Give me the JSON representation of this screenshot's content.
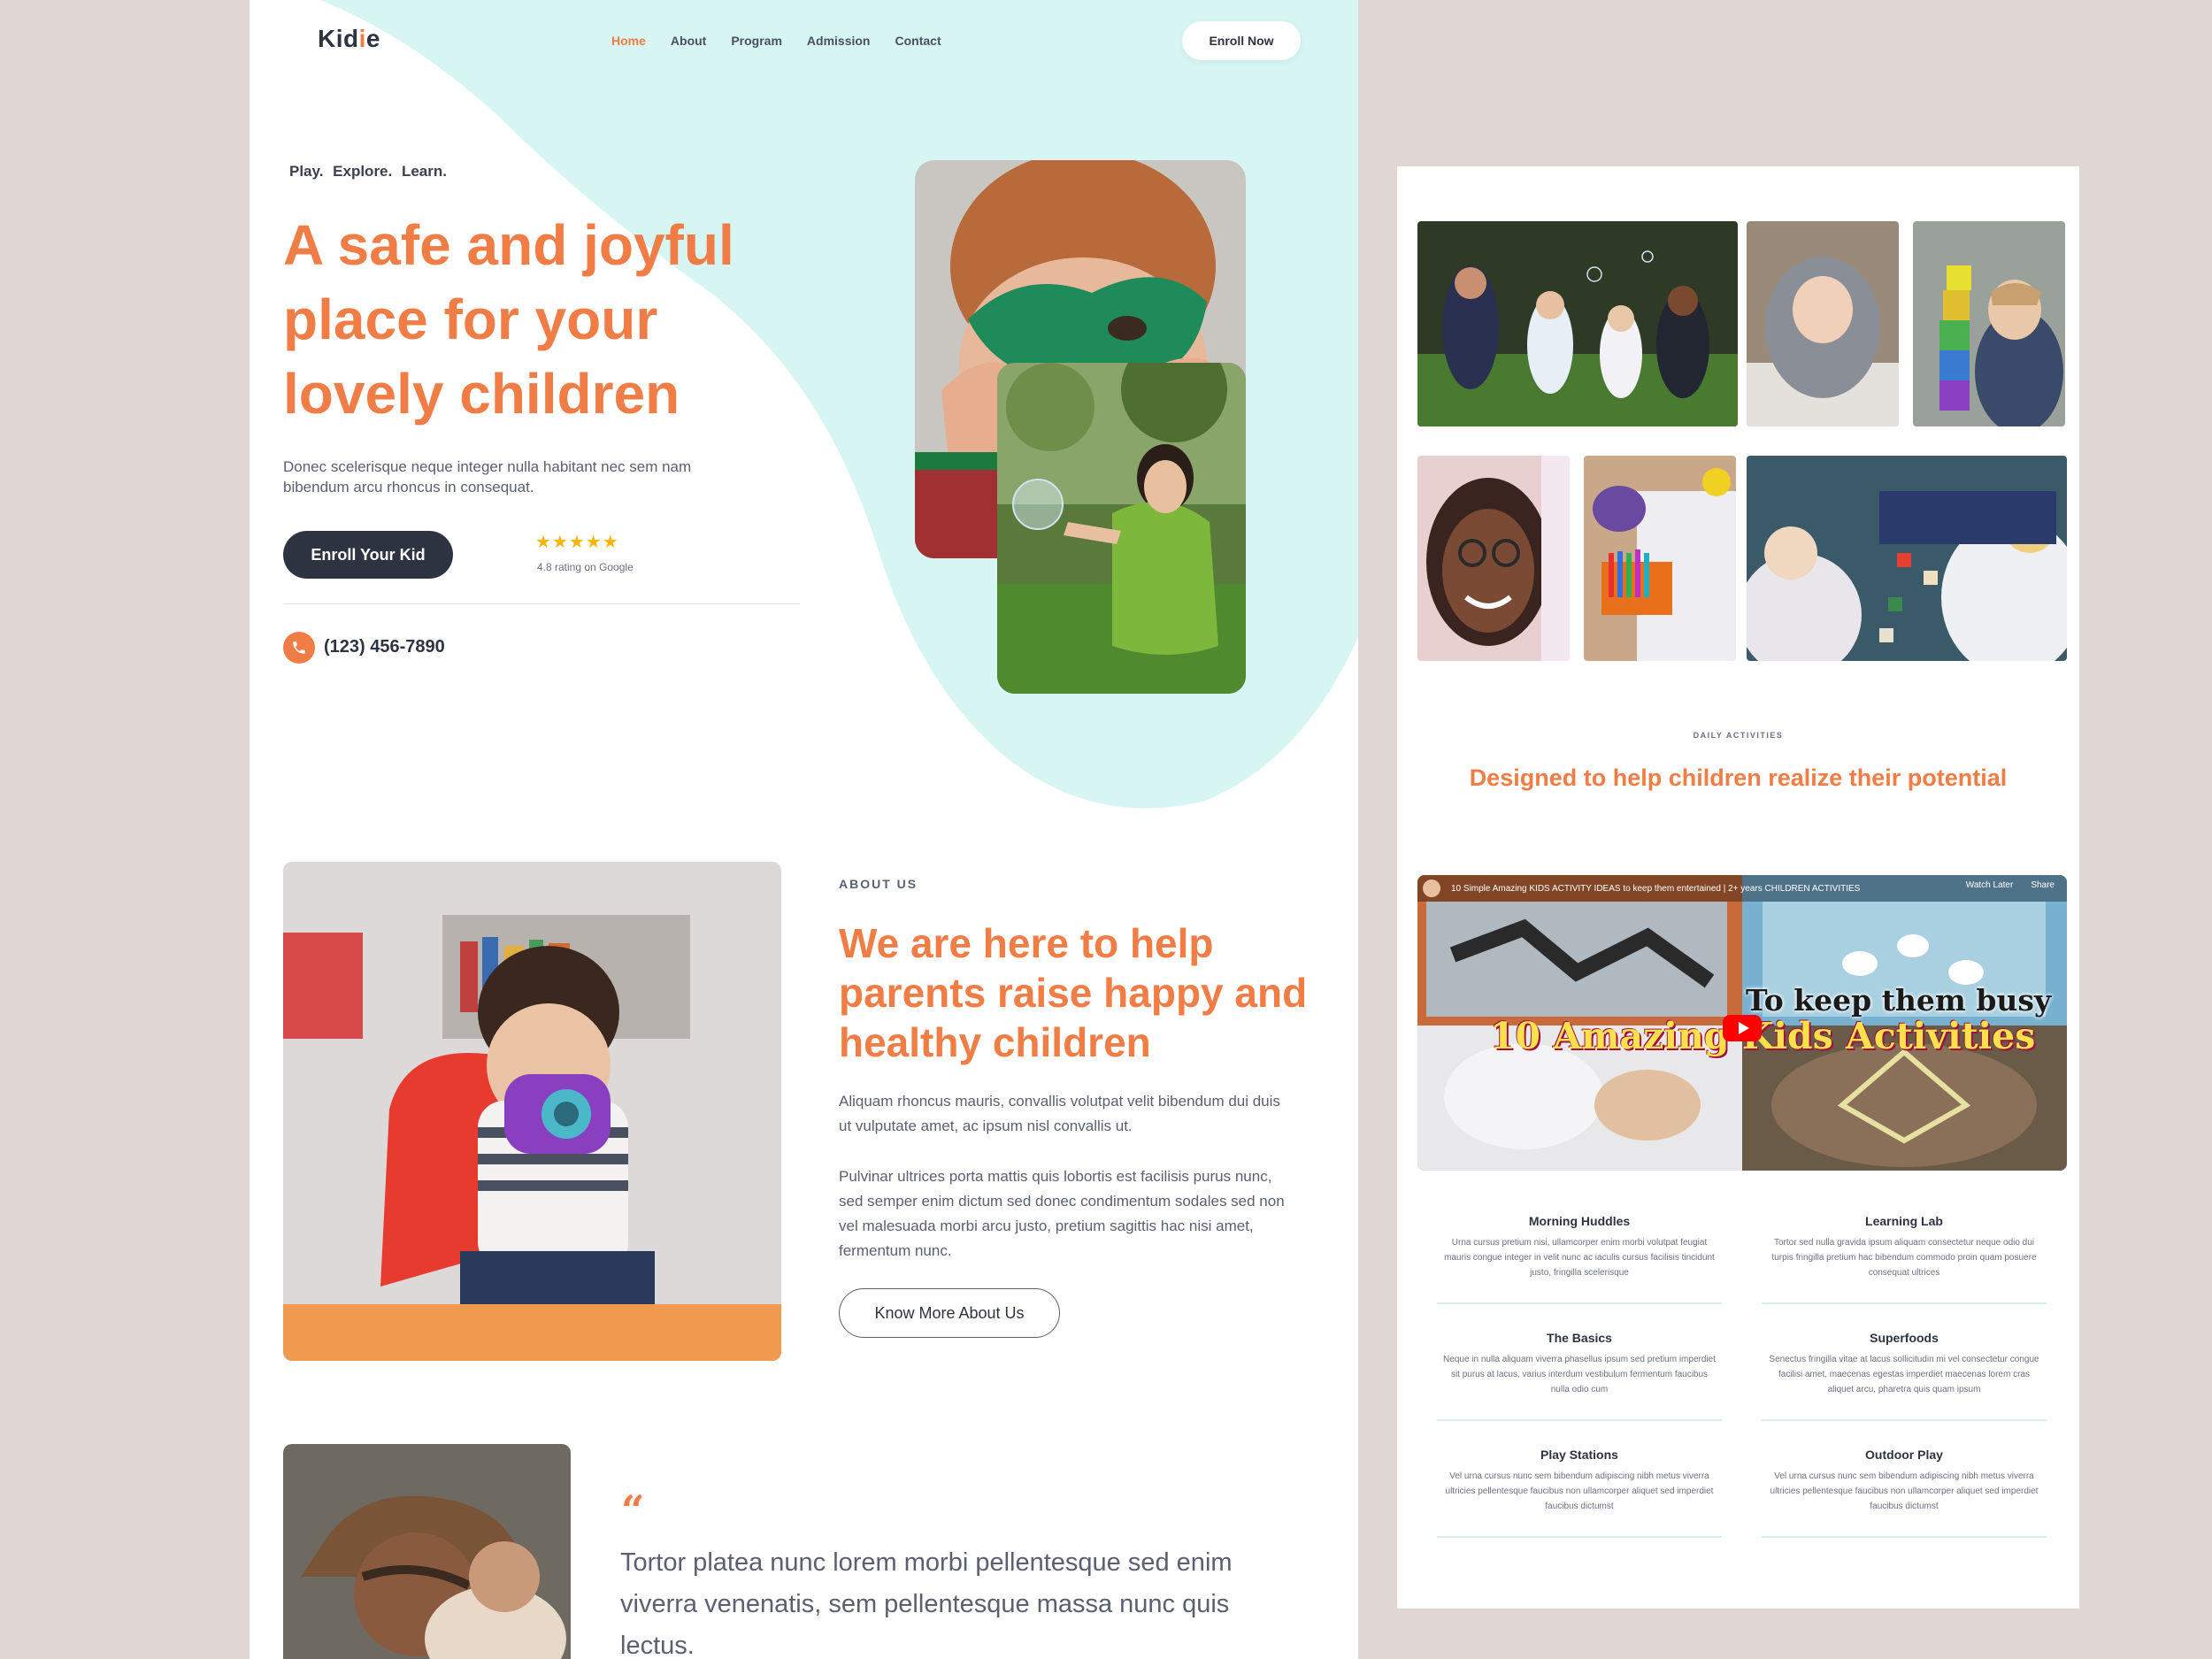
{
  "nav": {
    "logo": "Kidie",
    "links": [
      "Home",
      "About",
      "Program",
      "Admission",
      "Contact"
    ],
    "active": "Home",
    "cta": "Enroll Now"
  },
  "hero": {
    "tagline": "Play.  Explore.  Learn.",
    "title": "A safe and joyful place for your lovely children",
    "description": "Donec scelerisque neque integer nulla habitant nec sem nam bibendum arcu rhoncus in consequat.",
    "cta": "Enroll Your Kid",
    "rating_stars": "★★★★★",
    "rating_value": 4.8,
    "rating_text": "4.8 rating on Google",
    "phone": "(123) 456-7890"
  },
  "about": {
    "label": "ABOUT US",
    "title": "We are here to help parents raise happy and healthy children",
    "p1": "Aliquam rhoncus mauris, convallis volutpat velit bibendum dui duis ut vulputate amet, ac ipsum nisl convallis ut.",
    "p2": "Pulvinar ultrices porta mattis quis lobortis est facilisis purus nunc, sed semper enim dictum sed donec condimentum sodales sed non vel malesuada morbi arcu justo, pretium sagittis hac nisi amet, fermentum nunc.",
    "cta": "Know More About Us"
  },
  "testimonial": {
    "quote_mark": "“",
    "text": "Tortor platea nunc lorem morbi pellentesque sed enim viverra venenatis, sem pellentesque massa nunc quis lectus."
  },
  "activities_section": {
    "label": "DAILY ACTIVITIES",
    "title": "Designed to help children realize their potential",
    "video": {
      "title": "10 Simple Amazing KIDS ACTIVITY IDEAS to keep them entertained | 2+ years CHILDREN ACTIVITIES",
      "overlay_line1": "To keep them busy",
      "overlay_line2": "10 Amazing Kids Activities",
      "watch_later": "Watch Later",
      "share": "Share"
    },
    "items": [
      {
        "title": "Morning Huddles",
        "desc": "Urna cursus pretium nisi, ullamcorper enim morbi volutpat feugiat mauris congue integer in velit nunc ac iaculis cursus facilisis tincidunt justo, fringilla scelerisque"
      },
      {
        "title": "Learning Lab",
        "desc": "Tortor sed nulla gravida ipsum aliquam consectetur neque odio dui turpis fringilla pretium hac bibendum commodo proin quam posuere consequat ultrices"
      },
      {
        "title": "The Basics",
        "desc": "Neque in nulla aliquam viverra phasellus ipsum sed pretium imperdiet sit purus at lacus, varius interdum vestibulum fermentum faucibus nulla odio cum"
      },
      {
        "title": "Superfoods",
        "desc": "Senectus fringilla vitae at lacus sollicitudin mi vel consectetur congue facilisi amet, maecenas egestas imperdiet maecenas lorem cras aliquet arcu, pharetra quis quam ipsum"
      },
      {
        "title": "Play Stations",
        "desc": "Vel urna cursus nunc sem bibendum adipiscing nibh metus viverra ultricies pellentesque faucibus non ullamcorper aliquet sed imperdiet faucibus dictumst"
      },
      {
        "title": "Outdoor Play",
        "desc": "Vel urna cursus nunc sem bibendum adipiscing nibh metus viverra ultricies pellentesque faucibus non ullamcorper aliquet sed imperdiet faucibus dictumst"
      }
    ]
  },
  "colors": {
    "accent": "#f07d45",
    "dark": "#2d3340",
    "mint": "#d6f5f3",
    "backdrop": "#e0d6d3"
  },
  "icons": {
    "phone": "phone-icon",
    "star": "star-icon",
    "quote": "quote-icon",
    "play": "play-icon"
  }
}
